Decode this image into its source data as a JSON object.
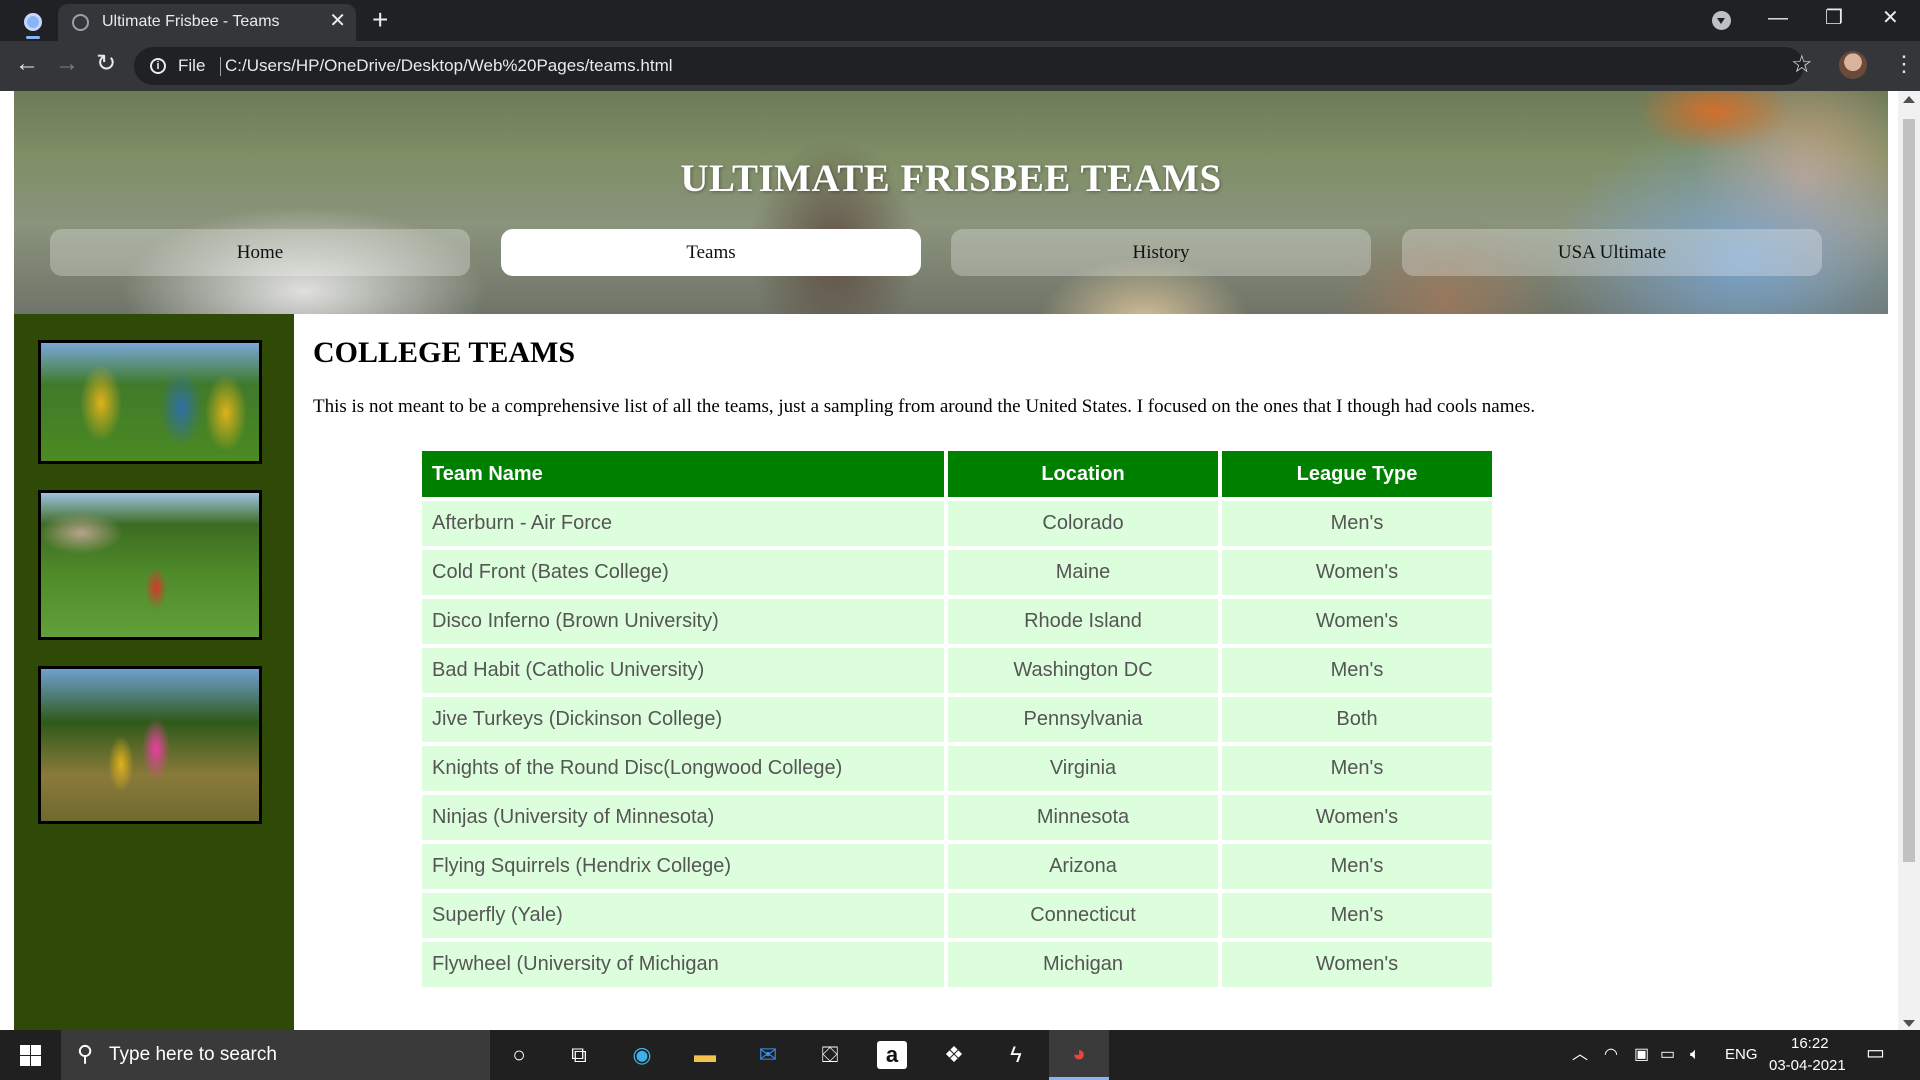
{
  "browser": {
    "tab_title": "Ultimate Frisbee - Teams",
    "tab_close": "✕",
    "new_tab": "+",
    "window_minimize": "—",
    "window_restore": "❐",
    "window_close": "✕",
    "nav_back": "←",
    "nav_forward": "→",
    "nav_reload": "↻",
    "file_label": "File",
    "url": "C:/Users/HP/OneDrive/Desktop/Web%20Pages/teams.html",
    "bookmark_star": "☆",
    "menu": "⋮"
  },
  "page": {
    "title": "ULTIMATE FRISBEE TEAMS",
    "nav": [
      {
        "label": "Home",
        "active": false
      },
      {
        "label": "Teams",
        "active": true
      },
      {
        "label": "History",
        "active": false
      },
      {
        "label": "USA Ultimate",
        "active": false
      }
    ],
    "heading": "COLLEGE TEAMS",
    "intro": "This is not meant to be a comprehensive list of all the teams, just a sampling from around the United States. I focused on the ones that I though had cools names.",
    "sidebar_photos": [
      "frisbee-players-photo",
      "frisbee-field-photo",
      "frisbee-game-photo"
    ],
    "table": {
      "headers": [
        "Team Name",
        "Location",
        "League Type"
      ],
      "rows": [
        [
          "Afterburn - Air Force",
          "Colorado",
          "Men's"
        ],
        [
          "Cold Front (Bates College)",
          "Maine",
          "Women's"
        ],
        [
          "Disco Inferno (Brown University)",
          "Rhode Island",
          "Women's"
        ],
        [
          "Bad Habit (Catholic University)",
          "Washington DC",
          "Men's"
        ],
        [
          "Jive Turkeys (Dickinson College)",
          "Pennsylvania",
          "Both"
        ],
        [
          "Knights of the Round Disc(Longwood College)",
          "Virginia",
          "Men's"
        ],
        [
          "Ninjas (University of Minnesota)",
          "Minnesota",
          "Women's"
        ],
        [
          "Flying Squirrels (Hendrix College)",
          "Arizona",
          "Men's"
        ],
        [
          "Superfly (Yale)",
          "Connecticut",
          "Men's"
        ],
        [
          "Flywheel (University of Michigan",
          "Michigan",
          "Women's"
        ]
      ]
    },
    "colors": {
      "header_green": "#008000",
      "row_bg": "#ddfedd",
      "sidebar_bg": "#2f4a07"
    }
  },
  "taskbar": {
    "search_placeholder": "Type here to search",
    "language": "ENG",
    "time": "16:22",
    "date": "03-04-2021",
    "pinned_icons": [
      "cortana-icon",
      "task-view-icon",
      "edge-icon",
      "file-explorer-icon",
      "mail-icon",
      "store-icon",
      "amazon-icon",
      "dropbox-icon",
      "app-icon",
      "chrome-icon"
    ]
  }
}
